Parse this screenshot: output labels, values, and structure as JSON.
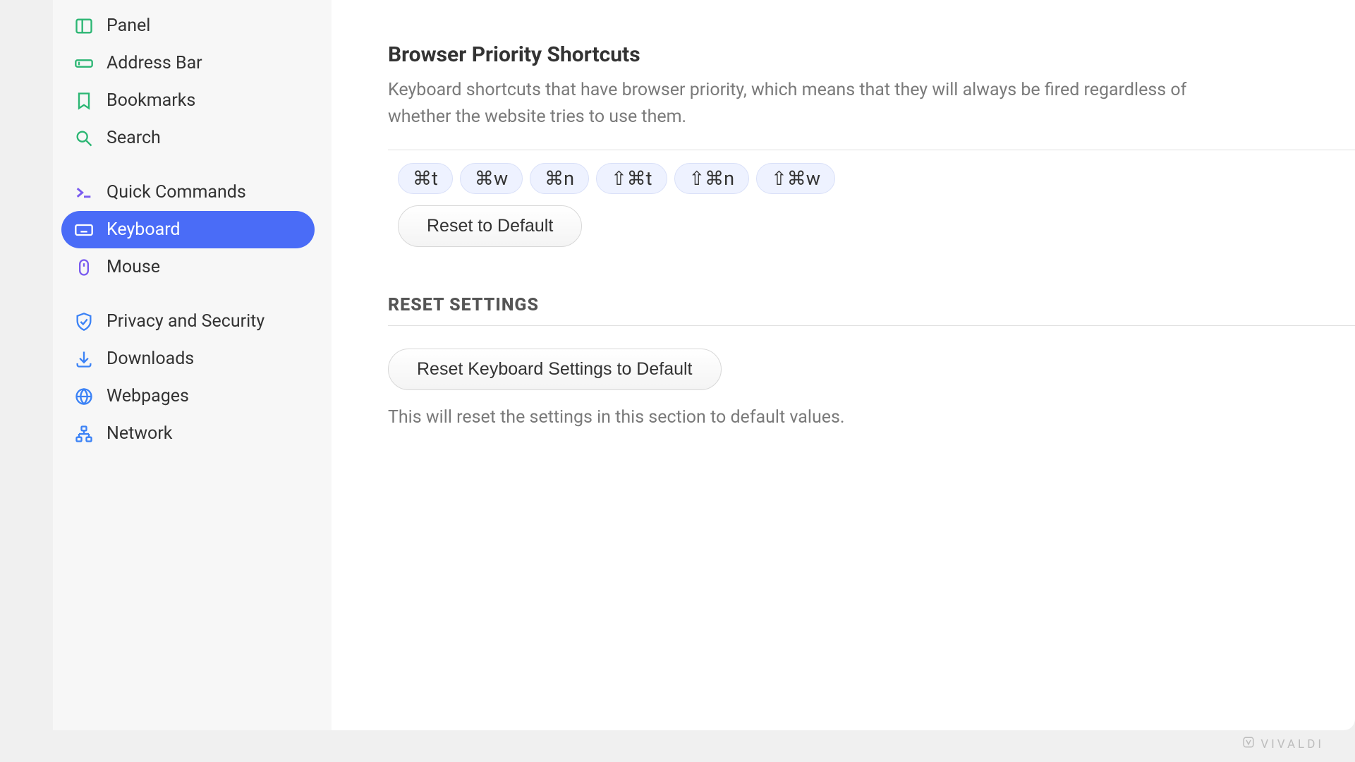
{
  "sidebar": {
    "group1": [
      {
        "label": "Panel",
        "icon": "panel"
      },
      {
        "label": "Address Bar",
        "icon": "address-bar"
      },
      {
        "label": "Bookmarks",
        "icon": "bookmark"
      },
      {
        "label": "Search",
        "icon": "search"
      }
    ],
    "group2": [
      {
        "label": "Quick Commands",
        "icon": "quick-commands"
      },
      {
        "label": "Keyboard",
        "icon": "keyboard",
        "active": true
      },
      {
        "label": "Mouse",
        "icon": "mouse"
      }
    ],
    "group3": [
      {
        "label": "Privacy and Security",
        "icon": "shield"
      },
      {
        "label": "Downloads",
        "icon": "download"
      },
      {
        "label": "Webpages",
        "icon": "globe"
      },
      {
        "label": "Network",
        "icon": "network"
      }
    ]
  },
  "main": {
    "priority": {
      "title": "Browser Priority Shortcuts",
      "desc": "Keyboard shortcuts that have browser priority, which means that they will always be fired regardless of whether the website tries to use them.",
      "pills": [
        "⌘t",
        "⌘w",
        "⌘n",
        "⇧⌘t",
        "⇧⌘n",
        "⇧⌘w"
      ],
      "reset_label": "Reset to Default"
    },
    "reset": {
      "subtitle": "RESET SETTINGS",
      "button": "Reset Keyboard Settings to Default",
      "desc": "This will reset the settings in this section to default values."
    }
  },
  "brand": "VIVALDI"
}
